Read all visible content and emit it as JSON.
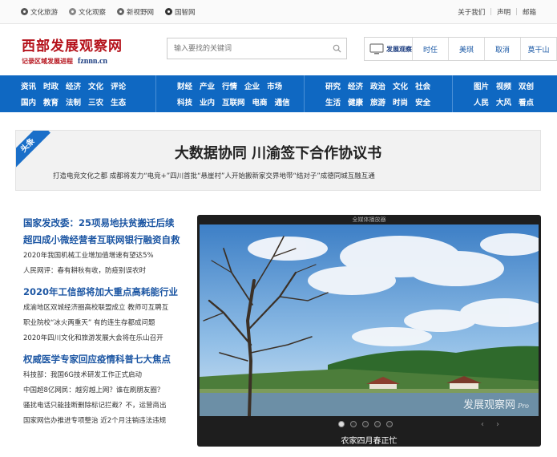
{
  "topbar": {
    "left_items": [
      {
        "icon": "culture-travel-icon",
        "label": "文化旅游"
      },
      {
        "icon": "culture-view-icon",
        "label": "文化观察"
      },
      {
        "icon": "new-view-icon",
        "label": "新视野网"
      },
      {
        "icon": "think-tank-icon",
        "label": "国智网"
      }
    ],
    "right_links": [
      "关于我们",
      "声明",
      "邮箱"
    ]
  },
  "header": {
    "logo_main": "西部发展观察网",
    "logo_sub": "记录区域发展进程",
    "logo_url": "fznnn.cn",
    "search_placeholder": "输入要找的关键词",
    "tv_label": "发展观察",
    "links": [
      "时任",
      "美琪",
      "取消",
      "莫干山"
    ]
  },
  "nav": {
    "groups": [
      {
        "row1": [
          "资讯",
          "时政",
          "经济",
          "文化",
          "评论"
        ],
        "row2": [
          "国内",
          "教育",
          "法制",
          "三农",
          "生态"
        ]
      },
      {
        "row1": [
          "财经",
          "产业",
          "行情",
          "企业",
          "市场"
        ],
        "row2": [
          "科技",
          "业内",
          "互联网",
          "电商",
          "通信"
        ]
      },
      {
        "row1": [
          "研究",
          "经济",
          "政治",
          "文化",
          "社会"
        ],
        "row2": [
          "生活",
          "健康",
          "旅游",
          "时尚",
          "安全"
        ]
      },
      {
        "row1": [
          "图片",
          "视频",
          "双创"
        ],
        "row2": [
          "人民",
          "大风",
          "看点"
        ]
      }
    ]
  },
  "headline": {
    "ribbon": "头条",
    "title": "大数据协同 川渝签下合作协议书",
    "subs": [
      "打造电竞文化之都 成都将发力“电竞+”",
      "四川首批“悬崖村”人开始搬新家",
      "交界地带“结对子”成德同城互融互通"
    ]
  },
  "news": [
    {
      "type": "big",
      "text": "国家发改委：25项易地扶贫搬迁后续"
    },
    {
      "type": "big",
      "text": "超四成小微经营者互联网银行融资自救"
    },
    {
      "type": "sm",
      "text": "2020年我国机械工业增加值增速有望达5%"
    },
    {
      "type": "sm",
      "text": "人民网评：春有耕秋有收，防疫别误农时"
    },
    {
      "type": "gap"
    },
    {
      "type": "big",
      "text": "2020年工信部将加大重点高耗能行业"
    },
    {
      "type": "sm",
      "text": "成渝地区双城经济圈高校联盟成立 教师可互聘互"
    },
    {
      "type": "sm",
      "text": "职业院校“冰火两重天” 有的连生存都成问题"
    },
    {
      "type": "sm",
      "text": "2020年四川文化和旅游发展大会将在乐山召开"
    },
    {
      "type": "gap"
    },
    {
      "type": "big",
      "text": "权威医学专家回应疫情科普七大焦点"
    },
    {
      "type": "sm",
      "text": "科技部：我国6G技术研发工作正式启动"
    },
    {
      "type": "sm",
      "text": "中国超8亿网民：越穷越上网？谁在刷朋友圈？"
    },
    {
      "type": "sm",
      "text": "骚扰电话只能挂断删除标记拦截？不，运营商出"
    },
    {
      "type": "sm",
      "text": "国家网信办推进专项整治 近2个月注销违法违规"
    }
  ],
  "player": {
    "title": "全媒体播放器",
    "watermark": "发展观察网",
    "watermark_pro": "Pro",
    "caption": "农家四月春正忙",
    "slide_count": 5,
    "active_slide": 1
  }
}
